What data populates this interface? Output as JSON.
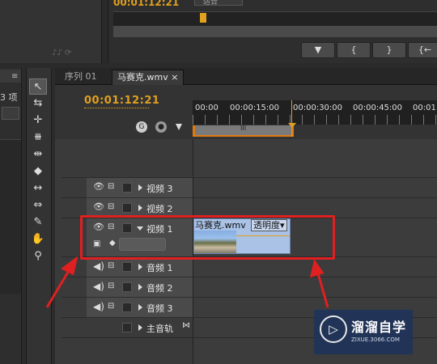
{
  "top": {
    "timecode": "00:01:12:21",
    "fit_label": "适合",
    "transport_buttons": [
      "▼",
      "{",
      "}",
      "{←"
    ]
  },
  "left_panel": {
    "count_label": "3 项"
  },
  "tabs": [
    {
      "label": "序列 01",
      "active": false
    },
    {
      "label": "马赛克.wmv",
      "active": true,
      "close": "×"
    }
  ],
  "timeline": {
    "timecode": "00:01:12:21",
    "ruler_ticks": [
      "00:00",
      "00:00:15:00",
      "00:00:30:00",
      "00:00:45:00",
      "00:01"
    ],
    "workarea_marker": "III"
  },
  "tracks": [
    {
      "name": "视频 3",
      "type": "video"
    },
    {
      "name": "视频 2",
      "type": "video"
    },
    {
      "name": "视频 1",
      "type": "video",
      "expanded": true
    },
    {
      "name": "音频 1",
      "type": "audio"
    },
    {
      "name": "音频 2",
      "type": "audio"
    },
    {
      "name": "音频 3",
      "type": "audio"
    },
    {
      "name": "主音轨",
      "type": "master"
    }
  ],
  "clip": {
    "name": "马赛克.wmv",
    "effect_dropdown": "透明度"
  },
  "watermark": {
    "title": "溜溜自学",
    "subtitle": "ZIXUE.3066.COM"
  },
  "colors": {
    "accent": "#e0a020",
    "highlight": "#e02020",
    "clip": "#a9c2e6"
  }
}
